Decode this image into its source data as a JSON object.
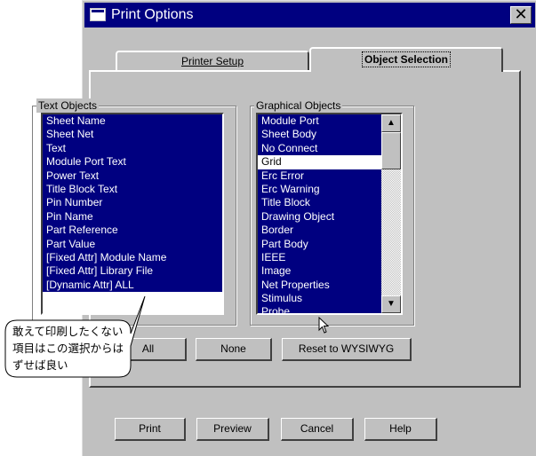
{
  "window": {
    "title": "Print Options",
    "close_symbol": "✕"
  },
  "tabs": [
    {
      "label": "Printer Setup",
      "active": false
    },
    {
      "label": "Object Selection",
      "active": true
    }
  ],
  "text_objects": {
    "label": "Text Objects",
    "items": [
      "Sheet Name",
      "Sheet Net",
      "Text",
      "Module Port Text",
      "Power Text",
      "Title Block Text",
      "Pin Number",
      "Pin Name",
      "Part Reference",
      "Part Value",
      "[Fixed Attr] Module Name",
      "[Fixed Attr] Library File",
      "[Dynamic Attr] ALL"
    ]
  },
  "graphical_objects": {
    "label": "Graphical Objects",
    "items": [
      "Module Port",
      "Sheet Body",
      "No Connect",
      "Grid",
      "Erc Error",
      "Erc Warning",
      "Title Block",
      "Drawing Object",
      "Border",
      "Part Body",
      "IEEE",
      "Image",
      "Net Properties",
      "Stimulus",
      "Probe"
    ],
    "unselected_item": "Grid"
  },
  "selection_buttons": {
    "all": "All",
    "none": "None",
    "reset": "Reset to WYSIWYG"
  },
  "dialog_buttons": {
    "print": "Print",
    "preview": "Preview",
    "cancel": "Cancel",
    "help": "Help"
  },
  "annotation": {
    "text": "敢えて印刷したくない項目はこの選択からはずせば良い"
  },
  "colors": {
    "title_bar": "#000080",
    "selection": "#000080",
    "dialog_bg": "#c0c0c0"
  }
}
